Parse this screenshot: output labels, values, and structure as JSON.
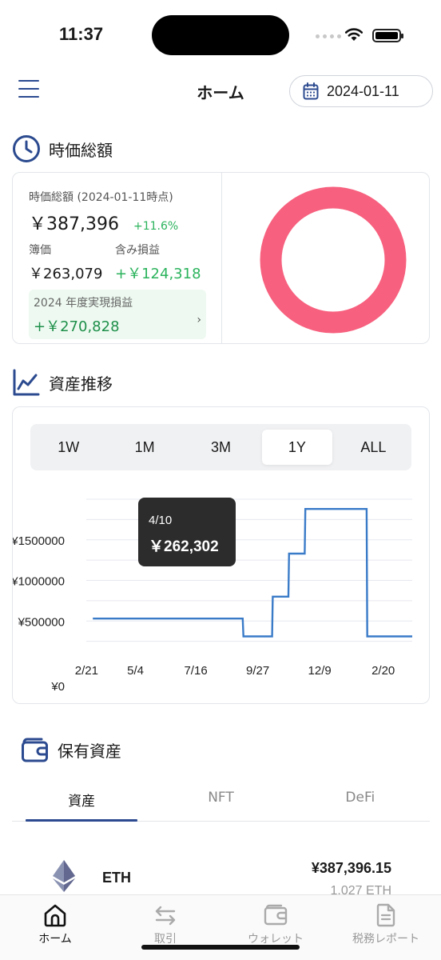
{
  "status_bar": {
    "time": "11:37"
  },
  "header": {
    "title": "ホーム",
    "date": "2024-01-11"
  },
  "market_value": {
    "section_title": "時価総額",
    "label": "時価総額 (2024-01-11時点)",
    "total": "￥387,396",
    "change": "+11.6%",
    "book_label": "簿価",
    "book_value": "￥263,079",
    "unrealized_label": "含み損益",
    "unrealized_value": "+￥124,318",
    "realized_label": "2024 年度実現損益",
    "realized_value": "+￥270,828",
    "realized_chevron": "›",
    "donut_color": "#f7607e"
  },
  "asset_trend": {
    "section_title": "資産推移",
    "ranges": [
      "1W",
      "1M",
      "3M",
      "1Y",
      "ALL"
    ],
    "active_range": "1Y",
    "tooltip": {
      "date": "4/10",
      "value": "￥262,302"
    }
  },
  "chart_data": {
    "type": "line",
    "x_tick_labels": [
      "2/21",
      "5/4",
      "7/16",
      "9/27",
      "12/9",
      "2/20"
    ],
    "y_tick_labels": [
      "¥0",
      "¥500000",
      "¥1000000",
      "¥1500000"
    ],
    "ylim": [
      0,
      2000000
    ],
    "grid": true,
    "line_color": "#3a7bc8",
    "points": [
      {
        "x": "2/21",
        "y": 530000
      },
      {
        "x": "8/10",
        "y": 530000
      },
      {
        "x": "8/11",
        "y": 310000
      },
      {
        "x": "9/19",
        "y": 310000
      },
      {
        "x": "9/20",
        "y": 800000
      },
      {
        "x": "10/8",
        "y": 800000
      },
      {
        "x": "10/9",
        "y": 1330000
      },
      {
        "x": "10/28",
        "y": 1330000
      },
      {
        "x": "10/29",
        "y": 1880000
      },
      {
        "x": "12/28",
        "y": 1880000
      },
      {
        "x": "12/29",
        "y": 310000
      },
      {
        "x": "2/20",
        "y": 310000
      }
    ],
    "x_fraction": [
      0.02,
      0.48,
      0.482,
      0.57,
      0.572,
      0.62,
      0.622,
      0.67,
      0.672,
      0.86,
      0.862,
      1.0
    ]
  },
  "holdings": {
    "section_title": "保有資産",
    "tabs": [
      "資産",
      "NFT",
      "DeFi"
    ],
    "active_tab": "資産",
    "assets": [
      {
        "symbol": "ETH",
        "value": "¥387,396.15",
        "quantity": "1.027 ETH"
      }
    ]
  },
  "bottom_nav": {
    "items": [
      {
        "label": "ホーム",
        "icon": "home-icon",
        "active": true
      },
      {
        "label": "取引",
        "icon": "swap-icon",
        "active": false
      },
      {
        "label": "ウォレット",
        "icon": "wallet-icon",
        "active": false
      },
      {
        "label": "税務レポート",
        "icon": "report-icon",
        "active": false
      }
    ]
  }
}
